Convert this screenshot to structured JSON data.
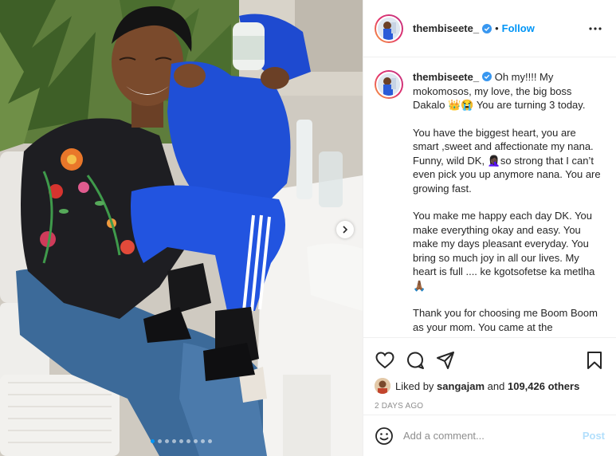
{
  "post": {
    "username": "thembiseete_",
    "separator": "•",
    "follow_label": "Follow",
    "caption_username": "thembiseete_",
    "caption_paragraphs": [
      "Oh my!!!! My mokomosos, my love, the big boss Dakalo 👑😭 You are turning 3 today.",
      "You have the biggest heart, you are smart ,sweet and affectionate my nana. Funny, wild DK, 🤦🏿‍♀️so strong that I can’t even pick you up anymore nana. You are growing fast.",
      "You make me happy each day DK. You make everything okay and easy. You make my days pleasant everyday. You bring so much joy in all our lives. My heart is full .... ke kgotsofetse ka metlha🙏🏾",
      "Thank you for choosing me Boom Boom as your mom. You came at the"
    ],
    "likes_prefix": "Liked by",
    "liked_by_user": "sangajam",
    "likes_connector": "and",
    "likes_others": "109,426 others",
    "date": "2 DAYS AGO",
    "comment_placeholder": "Add a comment...",
    "post_label": "Post"
  },
  "carousel": {
    "slide_count": 9,
    "active_index": 0
  },
  "colors": {
    "accent": "#0095f6",
    "post_disabled": "#b2dffc",
    "muted": "#8e8e8e",
    "text": "#262626"
  },
  "icons": {
    "verified": "verified-badge-icon",
    "more": "more-options-icon",
    "like": "heart-icon",
    "comment": "comment-icon",
    "share": "share-icon",
    "save": "bookmark-icon",
    "emoji": "emoji-icon",
    "next": "chevron-right-icon"
  }
}
